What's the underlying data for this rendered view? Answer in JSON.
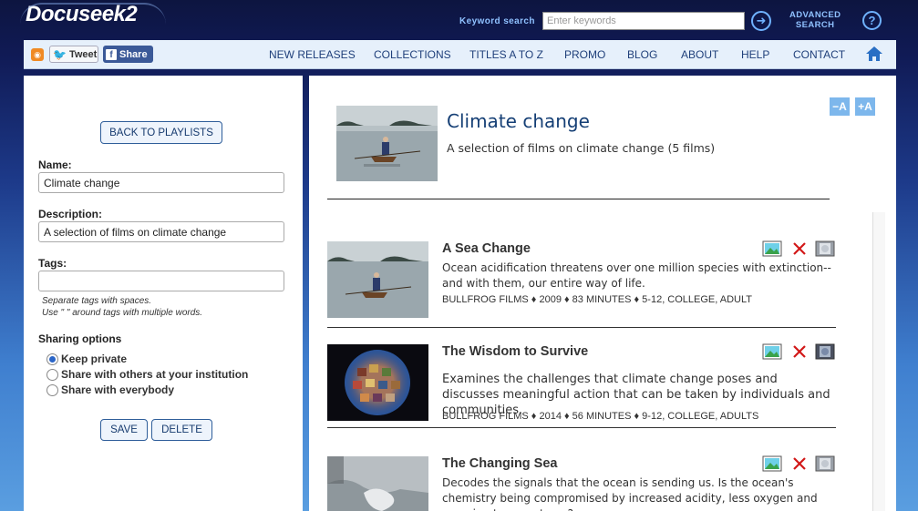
{
  "header": {
    "logo": "Docuseek2",
    "keyword_label": "Keyword search",
    "keyword_placeholder": "Enter keywords",
    "advanced_line1": "ADVANCED",
    "advanced_line2": "SEARCH",
    "go_icon": "arrow-right-circle-icon",
    "help_icon": "question-circle-icon"
  },
  "social": {
    "rss_icon": "rss-icon",
    "tweet": "Tweet",
    "share": "Share"
  },
  "nav": {
    "items": [
      "NEW RELEASES",
      "COLLECTIONS",
      "TITLES A TO Z",
      "PROMO",
      "BLOG",
      "ABOUT",
      "HELP",
      "CONTACT"
    ],
    "home_icon": "home-icon"
  },
  "sidebar": {
    "back_button": "BACK TO PLAYLISTS",
    "name_label": "Name:",
    "name_value": "Climate change",
    "description_label": "Description:",
    "description_value": "A selection of films on climate change",
    "tags_label": "Tags:",
    "tags_value": "",
    "hint_line1": "Separate tags with spaces.",
    "hint_line2": "Use \" \" around tags with multiple words.",
    "sharing_label": "Sharing options",
    "sharing_options": [
      "Keep private",
      "Share with others at your institution",
      "Share with everybody"
    ],
    "sharing_selected": 0,
    "save_button": "SAVE",
    "delete_button": "DELETE"
  },
  "playlist": {
    "title": "Climate change",
    "description": "A selection of films on climate change (5 films)",
    "font_minus": "−A",
    "font_plus": "+A"
  },
  "films": [
    {
      "title": "A Sea Change",
      "description": "Ocean acidification threatens over one million species with extinction--and with them, our entire way of life.",
      "meta": "BULLFROG FILMS ♦ 2009 ♦ 83 MINUTES ♦ 5-12, COLLEGE, ADULT"
    },
    {
      "title": "The Wisdom to Survive",
      "description": "Examines the challenges that climate change poses and discusses meaningful action that can be taken by individuals and communities.",
      "meta": "BULLFROG FILMS ♦ 2014 ♦ 56 MINUTES ♦ 9-12, COLLEGE, ADULTS"
    },
    {
      "title": "The Changing Sea",
      "description": "Decodes the signals that the ocean is sending us. Is the ocean's chemistry being compromised by increased acidity, less oxygen and warming temperatures?",
      "meta": ""
    }
  ],
  "colors": {
    "accent": "#153f75",
    "nav_bg": "#e6f0fb",
    "button_blue": "#7db7ec"
  }
}
